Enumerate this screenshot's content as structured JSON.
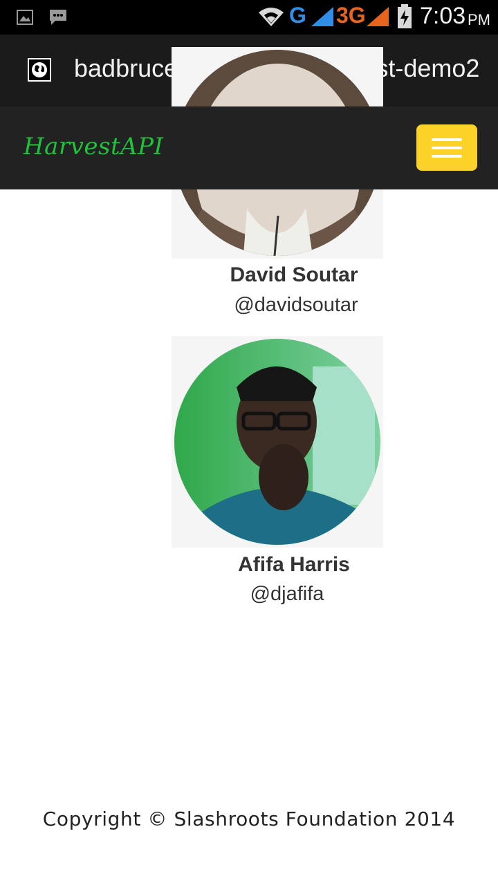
{
  "status_bar": {
    "time": "7:03",
    "ampm": "PM",
    "network_g": "G",
    "network_3g": "3G"
  },
  "browser": {
    "url": "badbruce07.github.io/harvest-demo2"
  },
  "navbar": {
    "brand": "HarvestAPI"
  },
  "team": [
    {
      "name": "David Soutar",
      "handle": "@davidsoutar"
    },
    {
      "name": "Afifa Harris",
      "handle": "@djafifa"
    }
  ],
  "footer": {
    "copyright": "Copyright © Slashroots Foundation 2014"
  },
  "colors": {
    "brand": "#1fc43a",
    "menu_button": "#fcd229",
    "navbar": "#222222",
    "g_indicator": "#2f8ee8",
    "threeg_indicator": "#e8631e"
  }
}
